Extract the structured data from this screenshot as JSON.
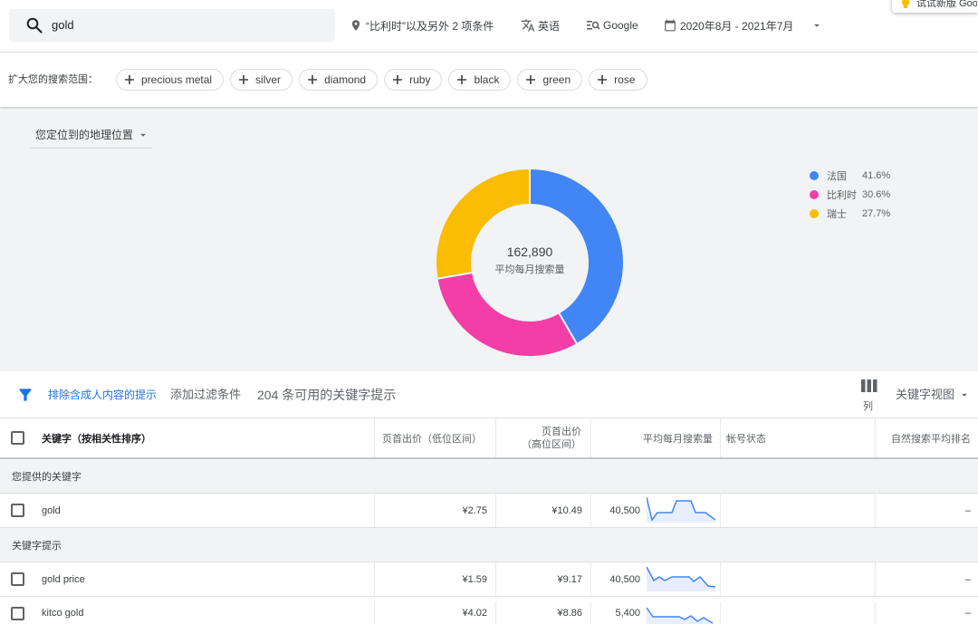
{
  "search": {
    "query": "gold"
  },
  "targeting": {
    "location": "“比利时”以及另外 2 项条件",
    "language": "英语",
    "network": "Google",
    "date_range": "2020年8月 - 2021年7月"
  },
  "promo": {
    "text": "试试新版 Goo"
  },
  "broaden": {
    "label": "扩大您的搜索范围：",
    "chips": [
      "precious metal",
      "silver",
      "diamond",
      "ruby",
      "black",
      "green",
      "rose"
    ]
  },
  "geo": {
    "dropdown_label": "您定位到的地理位置",
    "total": "162,890",
    "total_label": "平均每月搜索量",
    "segments": [
      {
        "name": "法国",
        "share": "41.6%",
        "color": "#4285f4"
      },
      {
        "name": "比利时",
        "share": "30.6%",
        "color": "#f23ea6"
      },
      {
        "name": "瑞士",
        "share": "27.7%",
        "color": "#fbbc04"
      }
    ]
  },
  "toolbar": {
    "exclude_adult": "排除含成人内容的提示",
    "add_filter": "添加过滤条件",
    "count_text": "204 条可用的关键字提示",
    "columns_label": "列",
    "view_label": "关键字视图"
  },
  "table": {
    "headers": {
      "keyword": "关键字（按相关性排序）",
      "bid_low": "页首出价（低位区间）",
      "bid_high_line1": "页首出价",
      "bid_high_line2": "（高位区间）",
      "avg_monthly": "平均每月搜索量",
      "account_status": "帐号状态",
      "organic_rank": "自然搜索平均排名"
    },
    "groups": [
      {
        "label": "您提供的关键字",
        "rows": [
          {
            "keyword": "gold",
            "bid_low": "¥2.75",
            "bid_high": "¥10.49",
            "avg_monthly": "40,500",
            "account_status": "",
            "organic_rank": "–"
          }
        ]
      },
      {
        "label": "关键字提示",
        "rows": [
          {
            "keyword": "gold price",
            "bid_low": "¥1.59",
            "bid_high": "¥9.17",
            "avg_monthly": "40,500",
            "account_status": "",
            "organic_rank": "–"
          },
          {
            "keyword": "kitco gold",
            "bid_low": "¥4.02",
            "bid_high": "¥8.86",
            "avg_monthly": "5,400",
            "account_status": "",
            "organic_rank": "–"
          }
        ]
      }
    ]
  },
  "colors": {
    "accent": "#1a73e8",
    "panel": "#f1f3f4",
    "sparkline": "#4285f4"
  }
}
